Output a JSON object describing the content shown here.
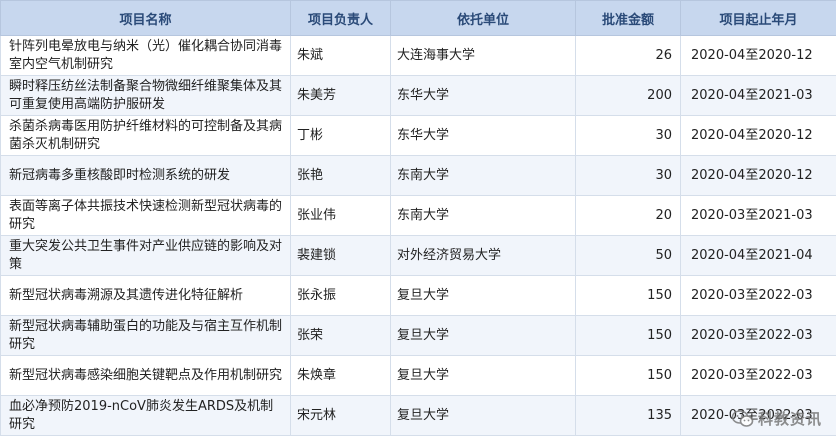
{
  "table": {
    "headers": [
      "项目名称",
      "项目负责人",
      "依托单位",
      "批准金额",
      "项目起止年月"
    ],
    "rows": [
      {
        "name": "针阵列电晕放电与纳米（光）催化耦合协同消毒室内空气机制研究",
        "leader": "朱斌",
        "unit": "大连海事大学",
        "amount": "26",
        "period": "2020-04至2020-12"
      },
      {
        "name": "瞬时释压纺丝法制备聚合物微细纤维聚集体及其可重复使用高端防护服研发",
        "leader": "朱美芳",
        "unit": "东华大学",
        "amount": "200",
        "period": "2020-04至2021-03"
      },
      {
        "name": "杀菌杀病毒医用防护纤维材料的可控制备及其病菌杀灭机制研究",
        "leader": "丁彬",
        "unit": "东华大学",
        "amount": "30",
        "period": "2020-04至2020-12"
      },
      {
        "name": "新冠病毒多重核酸即时检测系统的研发",
        "leader": "张艳",
        "unit": "东南大学",
        "amount": "30",
        "period": "2020-04至2020-12"
      },
      {
        "name": "表面等离子体共振技术快速检测新型冠状病毒的研究",
        "leader": "张业伟",
        "unit": "东南大学",
        "amount": "20",
        "period": "2020-03至2021-03"
      },
      {
        "name": "重大突发公共卫生事件对产业供应链的影响及对策",
        "leader": "裴建锁",
        "unit": "对外经济贸易大学",
        "amount": "50",
        "period": "2020-04至2021-04"
      },
      {
        "name": "新型冠状病毒溯源及其遗传进化特征解析",
        "leader": "张永振",
        "unit": "复旦大学",
        "amount": "150",
        "period": "2020-03至2022-03"
      },
      {
        "name": "新型冠状病毒辅助蛋白的功能及与宿主互作机制研究",
        "leader": "张荣",
        "unit": "复旦大学",
        "amount": "150",
        "period": "2020-03至2022-03"
      },
      {
        "name": "新型冠状病毒感染细胞关键靶点及作用机制研究",
        "leader": "朱焕章",
        "unit": "复旦大学",
        "amount": "150",
        "period": "2020-03至2022-03"
      },
      {
        "name": "血必净预防2019-nCoV肺炎发生ARDS及机制研究",
        "leader": "宋元林",
        "unit": "复旦大学",
        "amount": "135",
        "period": "2020-03至2022-03"
      }
    ]
  },
  "watermark": {
    "text": "科教资讯",
    "icon": "wechat-icon",
    "color": "#7a7a7a"
  },
  "colors": {
    "header_bg": "#c7d7ee",
    "header_text": "#2a4a78",
    "row_alt_bg": "#f1f5fb",
    "border": "#d5deea"
  }
}
